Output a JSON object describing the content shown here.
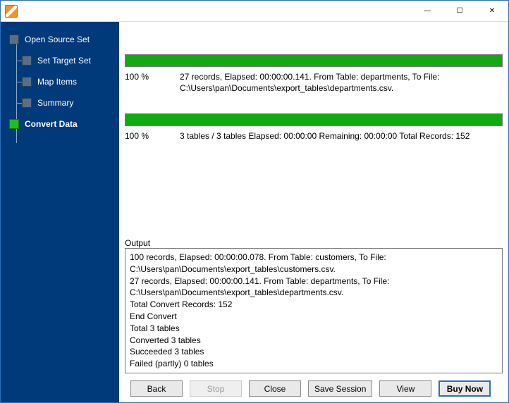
{
  "window": {
    "minimize_glyph": "—",
    "maximize_glyph": "☐",
    "close_glyph": "✕"
  },
  "sidebar": {
    "steps": [
      {
        "label": "Open Source Set"
      },
      {
        "label": "Set Target Set"
      },
      {
        "label": "Map Items"
      },
      {
        "label": "Summary"
      },
      {
        "label": "Convert Data"
      }
    ]
  },
  "progress1": {
    "pct": "100 %",
    "line": "27 records,    Elapsed: 00:00:00.141.    From Table: departments,    To File: C:\\Users\\pan\\Documents\\export_tables\\departments.csv."
  },
  "progress2": {
    "pct": "100 %",
    "line": "3 tables / 3 tables    Elapsed: 00:00:00    Remaining: 00:00:00    Total Records: 152"
  },
  "output": {
    "label": "Output",
    "lines": [
      "100 records,    Elapsed: 00:00:00.078.    From Table: customers,    To File: C:\\Users\\pan\\Documents\\export_tables\\customers.csv.",
      "27 records,    Elapsed: 00:00:00.141.    From Table: departments,    To File: C:\\Users\\pan\\Documents\\export_tables\\departments.csv.",
      "Total Convert Records: 152",
      "End Convert",
      "Total 3 tables",
      "Converted 3 tables",
      "Succeeded 3 tables",
      "Failed (partly) 0 tables"
    ]
  },
  "buttons": {
    "back": "Back",
    "stop": "Stop",
    "close": "Close",
    "save": "Save Session",
    "view": "View",
    "buy": "Buy Now"
  }
}
